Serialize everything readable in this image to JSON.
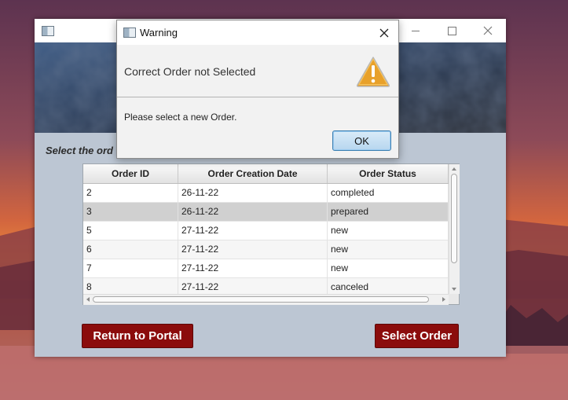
{
  "main_window": {
    "instruction_text": "Select the ord",
    "buttons": {
      "return_label": "Return to Portal",
      "select_label": "Select Order"
    }
  },
  "table": {
    "headers": [
      "Order ID",
      "Order Creation Date",
      "Order Status"
    ],
    "rows": [
      [
        "2",
        "26-11-22",
        "completed"
      ],
      [
        "3",
        "26-11-22",
        "prepared"
      ],
      [
        "5",
        "27-11-22",
        "new"
      ],
      [
        "6",
        "27-11-22",
        "new"
      ],
      [
        "7",
        "27-11-22",
        "new"
      ],
      [
        "8",
        "27-11-22",
        "canceled"
      ]
    ],
    "selected_row_index": 1
  },
  "dialog": {
    "title": "Warning",
    "header_text": "Correct Order not Selected",
    "body_text": "Please select a new Order.",
    "ok_label": "OK",
    "icon": "warning-triangle-icon"
  },
  "colors": {
    "button_dark_red": "#8b0c0c",
    "window_background": "#bcc6d3",
    "selected_row": "#d0d0d0",
    "warning_orange": "#e8a12b"
  }
}
